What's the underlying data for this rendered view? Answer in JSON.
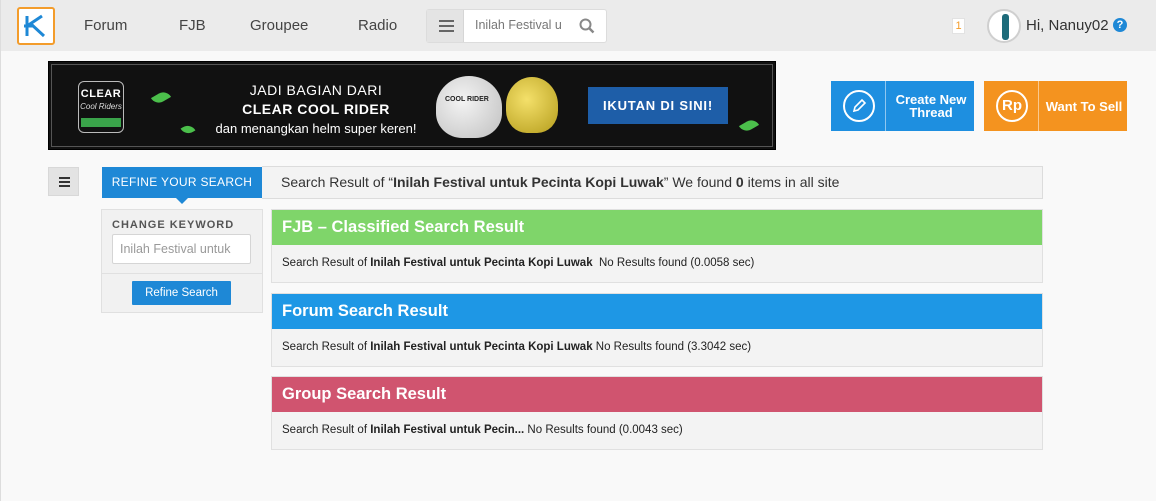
{
  "nav": {
    "links": [
      "Forum",
      "FJB",
      "Groupee",
      "Radio"
    ],
    "search_placeholder": "Inilah Festival u",
    "notification_count": "1",
    "greeting": "Hi, Nanuy02",
    "help": "?"
  },
  "banner": {
    "logo_word": "CLEAR",
    "logo_sub": "Cool Riders",
    "line1": "JADI BAGIAN DARI",
    "line2": "CLEAR COOL RIDER",
    "line3": "dan menangkan helm super keren!",
    "helmet_text": "COOL RIDER",
    "cta": "IKUTAN DI SINI!"
  },
  "actions": {
    "create_thread": "Create New Thread",
    "want_to_sell": "Want To Sell",
    "sell_icon": "Rp"
  },
  "sidebar": {
    "tab": "REFINE YOUR SEARCH",
    "keyword_label": "CHANGE KEYWORD",
    "keyword_value": "Inilah Festival untuk",
    "refine_button": "Refine Search"
  },
  "summary": {
    "prefix": "Search Result of “",
    "query": "Inilah Festival untuk Pecinta Kopi Luwak",
    "middle": "” We found ",
    "count": "0",
    "suffix": " items in all site"
  },
  "sections": [
    {
      "title": "FJB – Classified Search Result",
      "prefix": "Search Result of ",
      "query": "Inilah Festival untuk Pecinta Kopi Luwak",
      "result": "  No Results found (0.0058 sec)",
      "color": "#7fd56a"
    },
    {
      "title": "Forum Search Result",
      "prefix": "Search Result of ",
      "query": "Inilah Festival untuk Pecinta Kopi Luwak",
      "result": " No Results found (3.3042 sec)",
      "color": "#1e97e5"
    },
    {
      "title": "Group Search Result",
      "prefix": "Search Result of ",
      "query": "Inilah Festival untuk Pecin...",
      "result": " No Results found (0.0043 sec)",
      "color": "#d0546f"
    }
  ]
}
